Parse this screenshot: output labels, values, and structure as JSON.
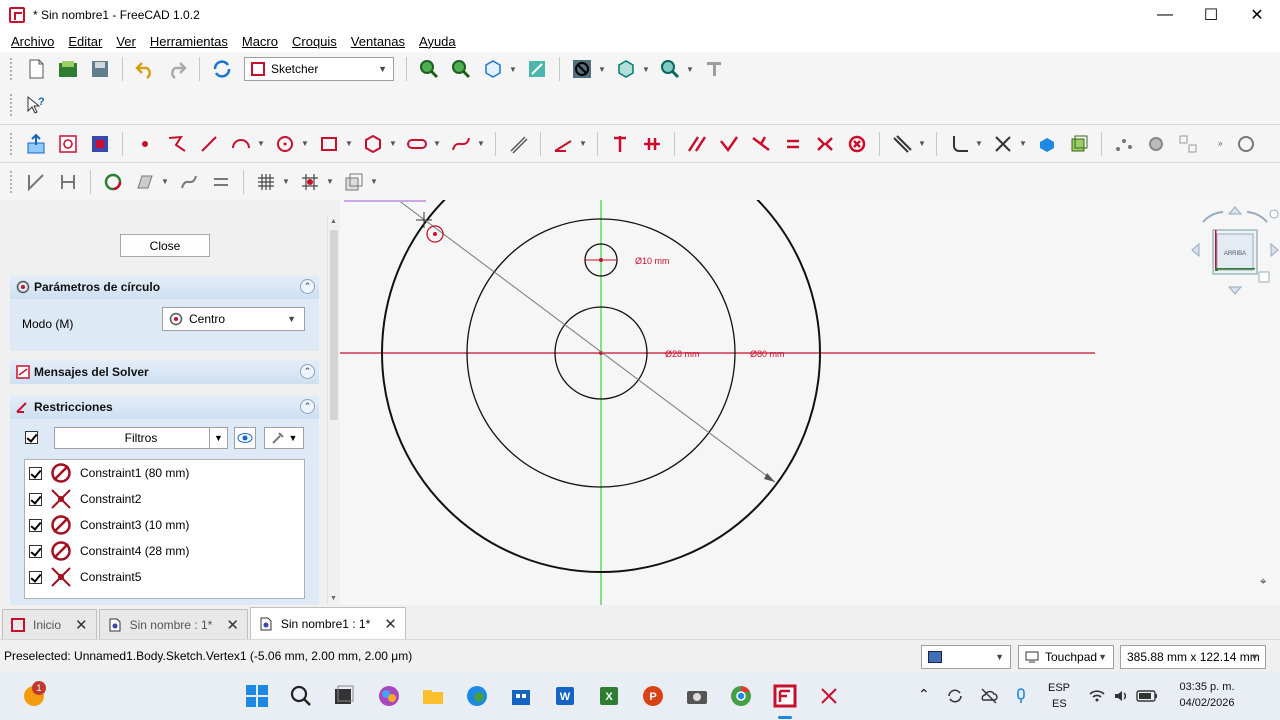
{
  "window": {
    "title": "* Sin nombre1 - FreeCAD 1.0.2",
    "minimize": "—",
    "maximize": "☐",
    "close": "✕"
  },
  "menu": [
    "Archivo",
    "Editar",
    "Ver",
    "Herramientas",
    "Macro",
    "Croquis",
    "Ventanas",
    "Ayuda"
  ],
  "toolbar": {
    "workbench": "Sketcher"
  },
  "panel": {
    "close_label": "Close",
    "circle_params": {
      "title": "Parámetros de círculo",
      "mode_label": "Modo (M)",
      "mode_value": "Centro"
    },
    "solver": {
      "title": "Mensajes del Solver"
    },
    "constraints": {
      "title": "Restricciones",
      "filter_label": "Filtros",
      "items": [
        {
          "label": "Constraint1 (80 mm)",
          "type": "diameter"
        },
        {
          "label": "Constraint2",
          "type": "coincident"
        },
        {
          "label": "Constraint3 (10 mm)",
          "type": "diameter"
        },
        {
          "label": "Constraint4 (28 mm)",
          "type": "diameter"
        },
        {
          "label": "Constraint5",
          "type": "coincident"
        }
      ]
    }
  },
  "sketch": {
    "dim_small": "Ø10 mm",
    "dim_inner": "Ø28 mm",
    "dim_outer": "Ø80 mm",
    "navcube_face": "ARRIBA",
    "axis_h_color": "#c8102e",
    "axis_v_color": "#33cc33"
  },
  "tabs": [
    {
      "label": "Inicio",
      "active": false
    },
    {
      "label": "Sin nombre : 1*",
      "active": false
    },
    {
      "label": "Sin nombre1 : 1*",
      "active": true
    }
  ],
  "status": {
    "message": "Preselected: Unnamed1.Body.Sketch.Vertex1 (-5.06 mm, 2.00 mm, 2.00 μm)",
    "nav_style": "Touchpad",
    "dimensions": "385.88 mm x 122.14 mm"
  },
  "taskbar": {
    "badge": "1",
    "lang_top": "ESP",
    "lang_bottom": "ES",
    "time": "03:35 p. m.",
    "date": "04/02/2026"
  }
}
